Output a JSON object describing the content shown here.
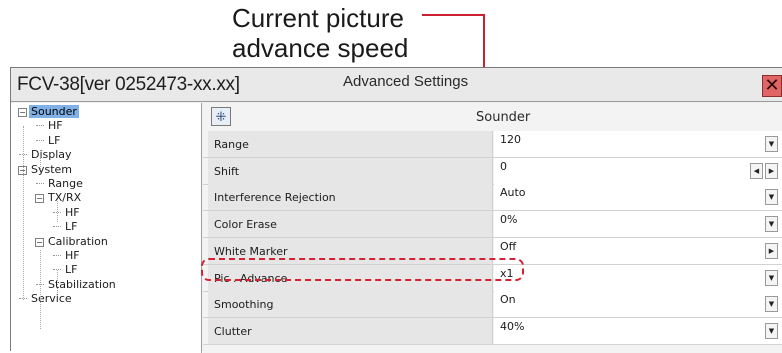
{
  "callout": {
    "line1": "Current picture",
    "line2": "advance speed"
  },
  "window": {
    "title": "FCV-38[ver 0252473-xx.xx]",
    "dialog_title": "Advanced Settings",
    "close_glyph": "✕"
  },
  "tree": [
    {
      "label": "Sounder",
      "indent": 0,
      "expander": "−",
      "selected": true
    },
    {
      "label": "HF",
      "indent": 1
    },
    {
      "label": "LF",
      "indent": 1
    },
    {
      "label": "Display",
      "indent": 0
    },
    {
      "label": "System",
      "indent": 0,
      "expander": "−"
    },
    {
      "label": "Range",
      "indent": 1
    },
    {
      "label": "TX/RX",
      "indent": 1,
      "expander": "−"
    },
    {
      "label": "HF",
      "indent": 2
    },
    {
      "label": "LF",
      "indent": 2
    },
    {
      "label": "Calibration",
      "indent": 1,
      "expander": "−"
    },
    {
      "label": "HF",
      "indent": 2
    },
    {
      "label": "LF",
      "indent": 2
    },
    {
      "label": "Stabilization",
      "indent": 1
    },
    {
      "label": "Service",
      "indent": 0
    }
  ],
  "section": {
    "label": "Sounder",
    "collapse_icon": "collapse-icon"
  },
  "settings": [
    {
      "name": "Range",
      "value": "120",
      "control": "dropdown"
    },
    {
      "name": "Shift",
      "value": "0",
      "control": "stepper"
    },
    {
      "name": "Interference Rejection",
      "value": "Auto",
      "control": "dropdown"
    },
    {
      "name": "Color Erase",
      "value": "0%",
      "control": "dropdown"
    },
    {
      "name": "White Marker",
      "value": "Off",
      "control": "next"
    },
    {
      "name": "Pic . Advance",
      "value": "x1",
      "control": "dropdown"
    },
    {
      "name": "Smoothing",
      "value": "On",
      "control": "dropdown"
    },
    {
      "name": "Clutter",
      "value": "40%",
      "control": "dropdown"
    }
  ],
  "icons": {
    "dropdown": "▼",
    "left": "◀",
    "right": "▶"
  },
  "colors": {
    "annotation": "#cc1f2f",
    "selection": "#7fb0e6",
    "close": "#e06565"
  }
}
